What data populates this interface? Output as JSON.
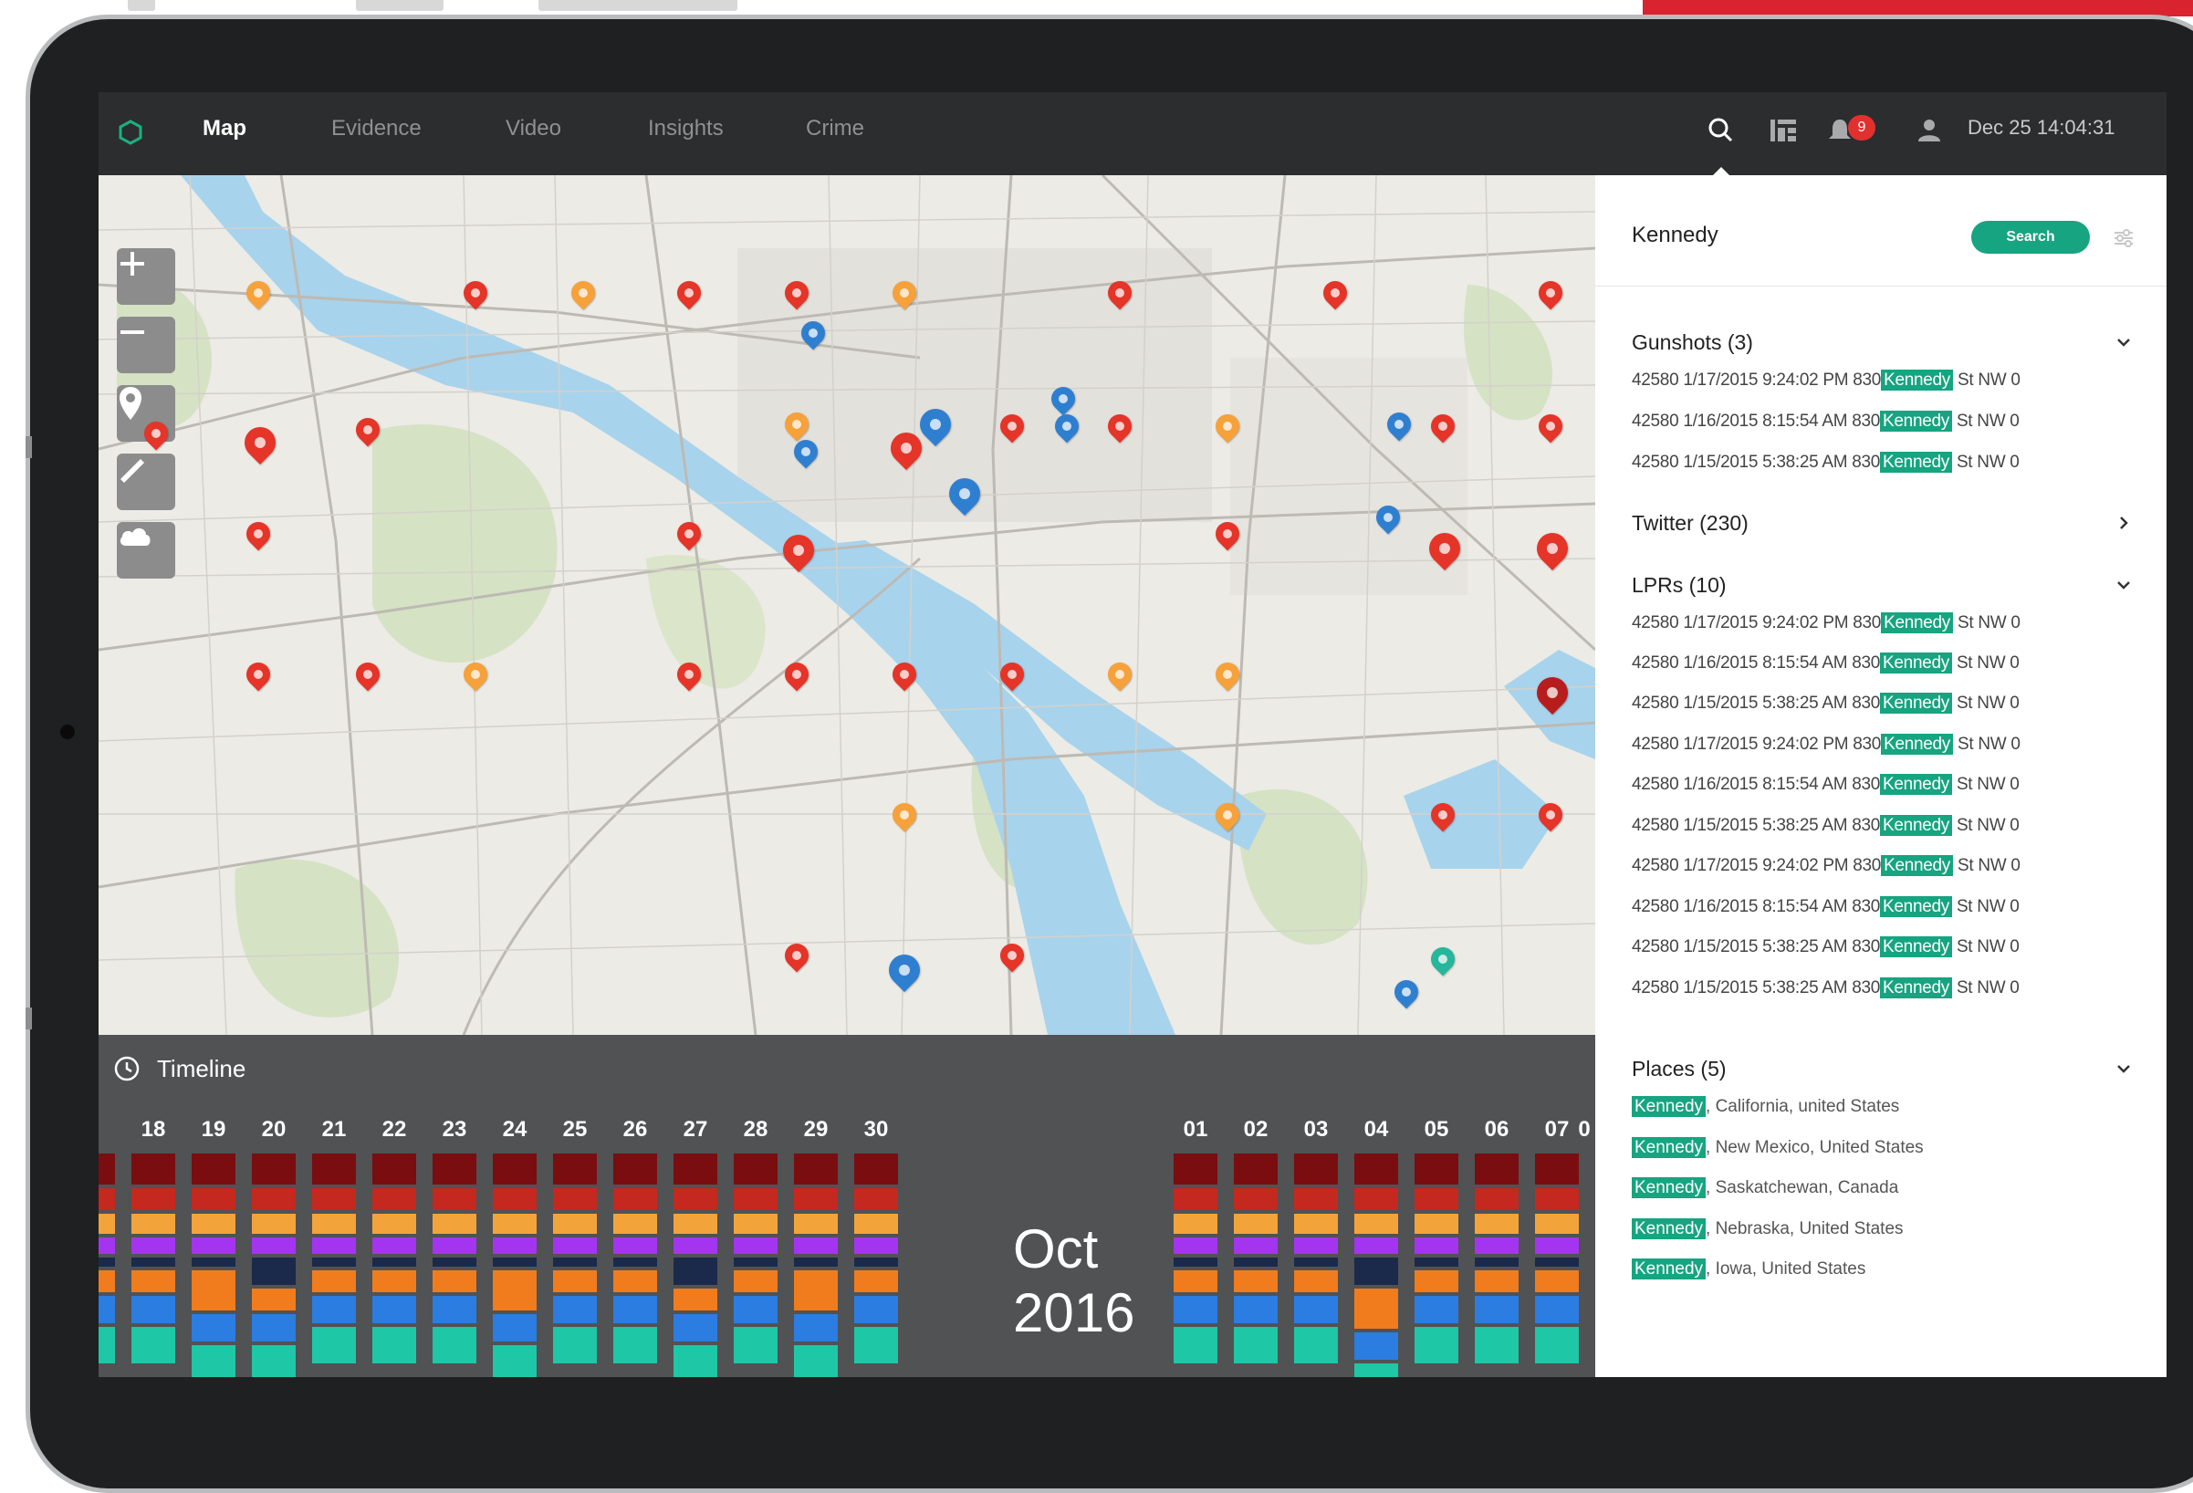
{
  "nav": {
    "tabs": [
      {
        "label": "Map",
        "active": true
      },
      {
        "label": "Evidence",
        "active": false
      },
      {
        "label": "Video",
        "active": false
      },
      {
        "label": "Insights",
        "active": false
      },
      {
        "label": "Crime",
        "active": false
      }
    ],
    "alert_count": "9",
    "datetime": "Dec 25 14:04:31",
    "icons": [
      "search-icon",
      "grid-icon",
      "bell-icon",
      "user-icon"
    ]
  },
  "map": {
    "controls": [
      "plus-icon",
      "minus-icon",
      "location-pin-icon",
      "ruler-icon",
      "cloud-icon"
    ]
  },
  "timeline": {
    "title": "Timeline",
    "month": "Oct",
    "year": "2016",
    "days": [
      "18",
      "19",
      "20",
      "21",
      "22",
      "23",
      "24",
      "25",
      "26",
      "27",
      "28",
      "29",
      "30",
      "",
      "",
      "",
      "01",
      "02",
      "03",
      "04",
      "05",
      "06",
      "07",
      "0"
    ]
  },
  "panel": {
    "query": "Kennedy",
    "search_label": "Search",
    "sections": {
      "gunshots": {
        "title": "Gunshots (3)",
        "rows": [
          {
            "prefix": "42580 1/17/2015 9:24:02 PM 830",
            "match": "Kennedy",
            "suffix": "St NW 0"
          },
          {
            "prefix": "42580 1/16/2015 8:15:54 AM 830",
            "match": "Kennedy",
            "suffix": "St NW 0"
          },
          {
            "prefix": "42580 1/15/2015 5:38:25 AM 830",
            "match": "Kennedy",
            "suffix": "St NW 0"
          }
        ]
      },
      "twitter": {
        "title": "Twitter (230)"
      },
      "lprs": {
        "title": "LPRs (10)",
        "rows": [
          {
            "prefix": "42580 1/17/2015 9:24:02 PM 830",
            "match": "Kennedy",
            "suffix": "St NW 0"
          },
          {
            "prefix": "42580 1/16/2015 8:15:54 AM 830",
            "match": "Kennedy",
            "suffix": "St NW 0"
          },
          {
            "prefix": "42580 1/15/2015 5:38:25 AM 830",
            "match": "Kennedy",
            "suffix": "St NW 0"
          },
          {
            "prefix": "42580 1/17/2015 9:24:02 PM 830",
            "match": "Kennedy",
            "suffix": "St NW 0"
          },
          {
            "prefix": "42580 1/16/2015 8:15:54 AM 830",
            "match": "Kennedy",
            "suffix": "St NW 0"
          },
          {
            "prefix": "42580 1/15/2015 5:38:25 AM 830",
            "match": "Kennedy",
            "suffix": "St NW 0"
          },
          {
            "prefix": "42580 1/17/2015 9:24:02 PM 830",
            "match": "Kennedy",
            "suffix": "St NW 0"
          },
          {
            "prefix": "42580 1/16/2015 8:15:54 AM 830",
            "match": "Kennedy",
            "suffix": "St NW 0"
          },
          {
            "prefix": "42580 1/15/2015 5:38:25 AM 830",
            "match": "Kennedy",
            "suffix": "St NW 0"
          },
          {
            "prefix": "42580 1/15/2015 5:38:25 AM 830",
            "match": "Kennedy",
            "suffix": "St NW 0"
          }
        ]
      },
      "places": {
        "title": "Places (5)",
        "rows": [
          {
            "match": "Kennedy",
            "suffix": ", California, united States"
          },
          {
            "match": "Kennedy",
            "suffix": ", New Mexico, United States"
          },
          {
            "match": "Kennedy",
            "suffix": ", Saskatchewan, Canada"
          },
          {
            "match": "Kennedy",
            "suffix": ", Nebraska, United States"
          },
          {
            "match": "Kennedy",
            "suffix": ", Iowa, United States"
          }
        ]
      }
    }
  },
  "colors": {
    "accent": "#17a480",
    "nav_bg": "#2c2d2e",
    "timeline_bg": "#505254",
    "alert": "#e0312f"
  }
}
